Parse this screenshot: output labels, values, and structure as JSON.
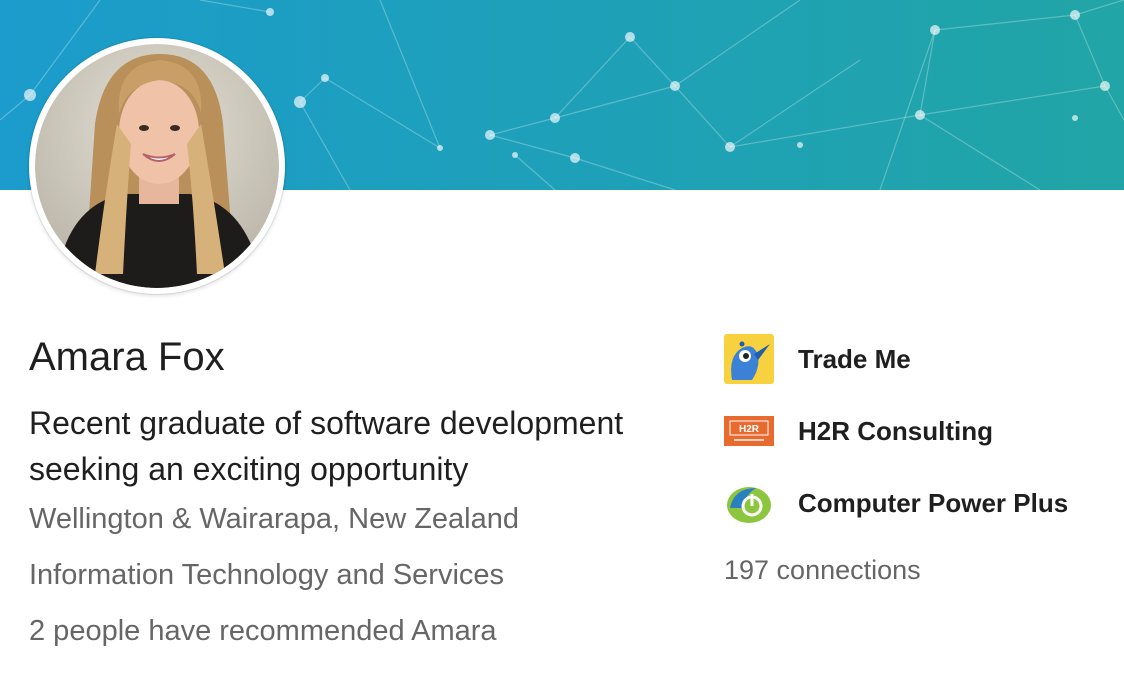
{
  "colors": {
    "banner_start": "#1b9ccc",
    "banner_end": "#21a5a6",
    "text_primary": "#1f1f1f",
    "text_secondary": "#666666"
  },
  "profile": {
    "name": "Amara Fox",
    "headline": "Recent graduate of software development seeking an exciting opportunity",
    "location": "Wellington & Wairarapa, New Zealand",
    "industry": "Information Technology and Services",
    "recommendations": "2 people have recommended Amara"
  },
  "companies": [
    {
      "label": "Trade Me",
      "icon": "trade-me-kiwi-logo"
    },
    {
      "label": "H2R Consulting",
      "icon": "h2r-consulting-logo",
      "logo_text": "H2R"
    },
    {
      "label": "Computer Power Plus",
      "icon": "computer-power-plus-logo"
    }
  ],
  "connections": "197 connections"
}
